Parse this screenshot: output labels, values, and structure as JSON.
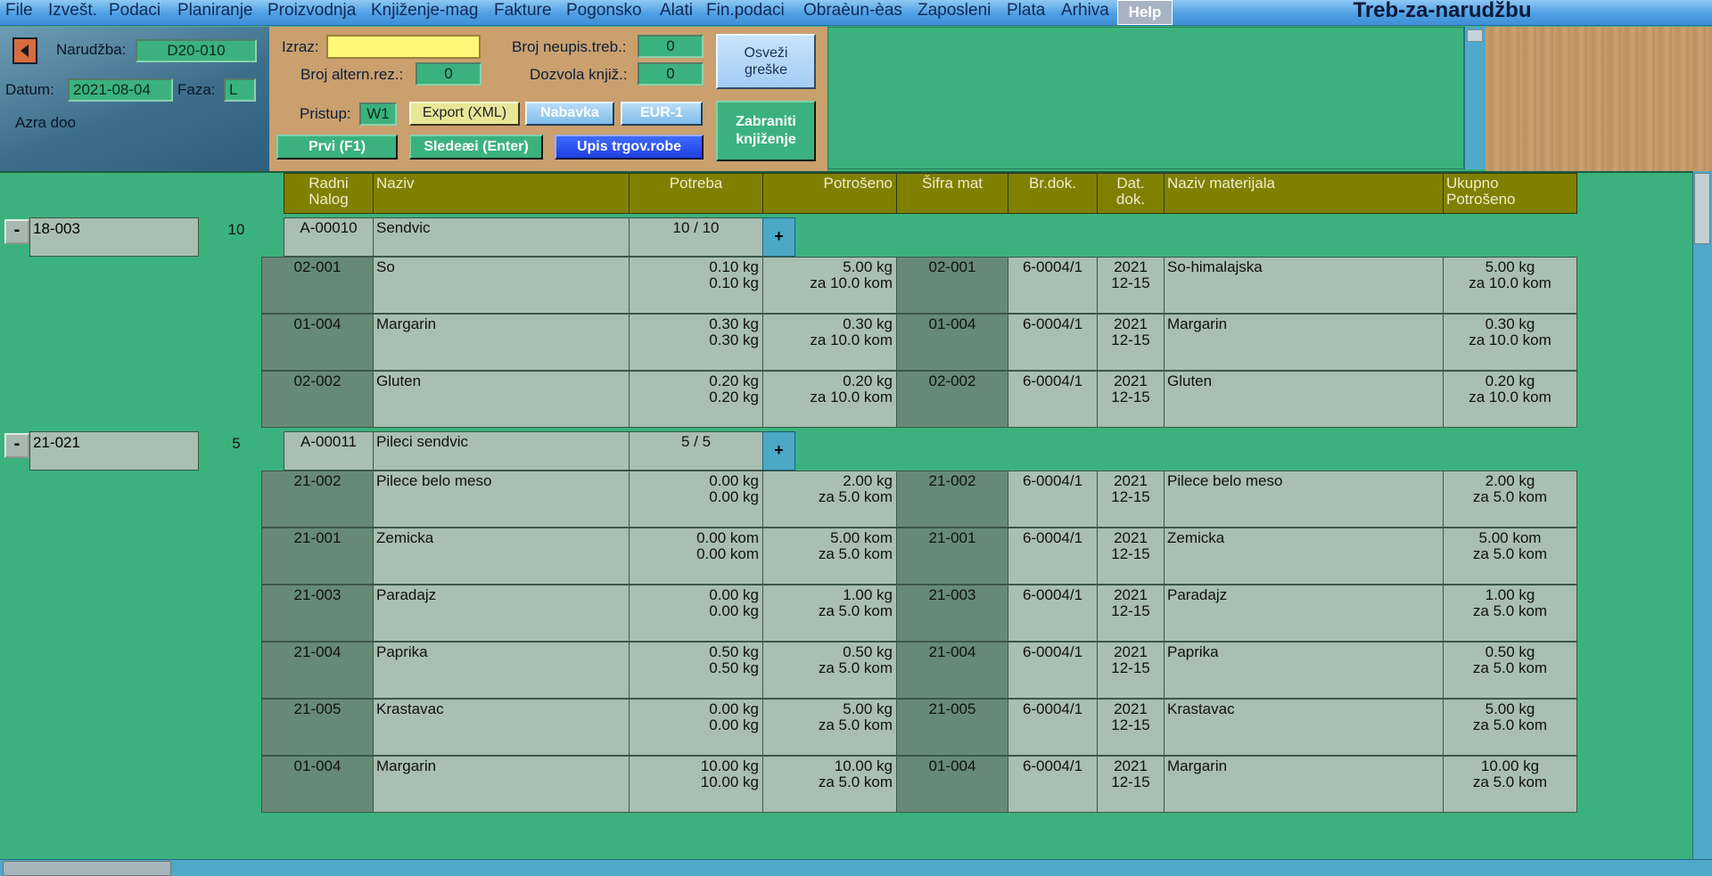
{
  "menu": {
    "items": [
      "File",
      "Izvešt.",
      "Podaci",
      "Planiranje",
      "Proizvodnja",
      "Knjiženje-mag",
      "Fakture",
      "Pogonsko",
      "Alati",
      "Fin.podaci",
      "Obraèun-èas",
      "Zaposleni",
      "Plata",
      "Arhiva"
    ],
    "help": "Help"
  },
  "window_title": "Treb-za-narudžbu",
  "left_panel": {
    "narudzba_label": "Narudžba:",
    "narudzba_value": "D20-010",
    "datum_label": "Datum:",
    "datum_value": "2021-08-04",
    "faza_label": "Faza:",
    "faza_value": "L",
    "company": "Azra doo"
  },
  "center_panel": {
    "izraz_label": "Izraz:",
    "izraz_value": "",
    "broj_altern_label": "Broj altern.rez.:",
    "broj_altern_value": "0",
    "broj_neupis_label": "Broj neupis.treb.:",
    "broj_neupis_value": "0",
    "dozvola_label": "Dozvola knjiž.:",
    "dozvola_value": "0",
    "osvezi_label": "Osveži\ngreške",
    "pristup_label": "Pristup:",
    "pristup_value": "W1",
    "export_label": "Export (XML)",
    "nabavka_label": "Nabavka",
    "eur_label": "EUR-1",
    "zabraniti_label": "Zabraniti\nknjiženje",
    "prvi_label": "Prvi (F1)",
    "sledeci_label": "Sledeæi (Enter)",
    "upis_label": "Upis trgov.robe"
  },
  "columns": [
    "Radni\nNalog",
    "Naziv",
    "Potreba",
    "Potrošeno",
    "Šifra mat",
    "Br.dok.",
    "Dat.\ndok.",
    "Naziv materijala",
    "Ukupno\nPotrošeno"
  ],
  "groups": [
    {
      "toggle": "-",
      "code": "18-003",
      "qty": "10",
      "product_code": "A-00010",
      "product_name": "Sendvic",
      "product_ratio": "10 / 10",
      "plus": "+",
      "rows": [
        {
          "rn": "02-001",
          "naziv": "So",
          "potreba": "0.10 kg\n0.10 kg",
          "potroseno": "5.00 kg\nza 10.0 kom",
          "sifra": "02-001",
          "brdok": "6-0004/1",
          "datdok": "2021\n12-15",
          "nazivmat": "So-himalajska",
          "ukupno": "5.00 kg\nza 10.0 kom"
        },
        {
          "rn": "01-004",
          "naziv": "Margarin",
          "potreba": "0.30 kg\n0.30 kg",
          "potroseno": "0.30 kg\nza 10.0 kom",
          "sifra": "01-004",
          "brdok": "6-0004/1",
          "datdok": "2021\n12-15",
          "nazivmat": "Margarin",
          "ukupno": "0.30 kg\nza 10.0 kom"
        },
        {
          "rn": "02-002",
          "naziv": "Gluten",
          "potreba": "0.20 kg\n0.20 kg",
          "potroseno": "0.20 kg\nza 10.0 kom",
          "sifra": "02-002",
          "brdok": "6-0004/1",
          "datdok": "2021\n12-15",
          "nazivmat": "Gluten",
          "ukupno": "0.20 kg\nza 10.0 kom"
        }
      ]
    },
    {
      "toggle": "-",
      "code": "21-021",
      "qty": "5",
      "product_code": "A-00011",
      "product_name": "Pileci sendvic",
      "product_ratio": "5 / 5",
      "plus": "+",
      "rows": [
        {
          "rn": "21-002",
          "naziv": "Pilece belo meso",
          "potreba": "0.00 kg\n0.00 kg",
          "potroseno": "2.00 kg\nza 5.0 kom",
          "sifra": "21-002",
          "brdok": "6-0004/1",
          "datdok": "2021\n12-15",
          "nazivmat": "Pilece belo meso",
          "ukupno": "2.00 kg\nza 5.0 kom"
        },
        {
          "rn": "21-001",
          "naziv": "Zemicka",
          "potreba": "0.00 kom\n0.00 kom",
          "potroseno": "5.00 kom\nza 5.0 kom",
          "sifra": "21-001",
          "brdok": "6-0004/1",
          "datdok": "2021\n12-15",
          "nazivmat": "Zemicka",
          "ukupno": "5.00 kom\nza 5.0 kom"
        },
        {
          "rn": "21-003",
          "naziv": "Paradajz",
          "potreba": "0.00 kg\n0.00 kg",
          "potroseno": "1.00 kg\nza 5.0 kom",
          "sifra": "21-003",
          "brdok": "6-0004/1",
          "datdok": "2021\n12-15",
          "nazivmat": "Paradajz",
          "ukupno": "1.00 kg\nza 5.0 kom"
        },
        {
          "rn": "21-004",
          "naziv": "Paprika",
          "potreba": "0.50 kg\n0.50 kg",
          "potroseno": "0.50 kg\nza 5.0 kom",
          "sifra": "21-004",
          "brdok": "6-0004/1",
          "datdok": "2021\n12-15",
          "nazivmat": "Paprika",
          "ukupno": "0.50 kg\nza 5.0 kom"
        },
        {
          "rn": "21-005",
          "naziv": "Krastavac",
          "potreba": "0.00 kg\n0.00 kg",
          "potroseno": "5.00 kg\nza 5.0 kom",
          "sifra": "21-005",
          "brdok": "6-0004/1",
          "datdok": "2021\n12-15",
          "nazivmat": "Krastavac",
          "ukupno": "5.00 kg\nza 5.0 kom"
        },
        {
          "rn": "01-004",
          "naziv": "Margarin",
          "potreba": "10.00 kg\n10.00 kg",
          "potroseno": "10.00 kg\nza 5.0 kom",
          "sifra": "01-004",
          "brdok": "6-0004/1",
          "datdok": "2021\n12-15",
          "nazivmat": "Margarin",
          "ukupno": "10.00 kg\nza 5.0 kom"
        }
      ]
    }
  ]
}
